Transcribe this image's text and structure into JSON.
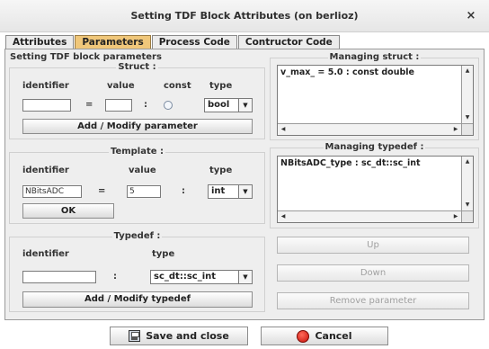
{
  "window": {
    "title": "Setting TDF Block Attributes (on berlioz)",
    "close_glyph": "×"
  },
  "tabs": [
    {
      "label": "Attributes",
      "active": false
    },
    {
      "label": "Parameters",
      "active": true
    },
    {
      "label": "Process Code",
      "active": false
    },
    {
      "label": "Contructor Code",
      "active": false
    }
  ],
  "setting": {
    "title": "Setting TDF block parameters"
  },
  "struct": {
    "title": "Struct :",
    "col_identifier": "identifier",
    "col_value": "value",
    "col_const": "const",
    "col_type": "type",
    "identifier_value": "",
    "equals": "=",
    "value_value": "",
    "colon": ":",
    "type_value": "bool",
    "button_label": "Add / Modify parameter"
  },
  "template": {
    "title": "Template :",
    "col_identifier": "identifier",
    "col_value": "value",
    "col_type": "type",
    "identifier_value": "NBitsADC",
    "equals": "=",
    "value_value": "5",
    "colon": ":",
    "type_value": "int",
    "button_label": "OK"
  },
  "typedef": {
    "title": "Typedef :",
    "col_identifier": "identifier",
    "col_type": "type",
    "identifier_value": "",
    "colon": ":",
    "type_value": "sc_dt::sc_int",
    "button_label": "Add / Modify typedef"
  },
  "managing_struct": {
    "title": "Managing struct :",
    "items": [
      "v_max_ = 5.0 : const double"
    ]
  },
  "managing_typedef": {
    "title": "Managing typedef :",
    "items": [
      "NBitsADC_type : sc_dt::sc_int"
    ]
  },
  "actions": {
    "up_label": "Up",
    "down_label": "Down",
    "remove_label": "Remove parameter"
  },
  "footer": {
    "save_label": "Save and close",
    "cancel_label": "Cancel"
  },
  "scroll_glyphs": {
    "up": "▲",
    "down": "▼",
    "left": "◀",
    "right": "▶"
  },
  "icons": {
    "save": "floppy-disk-icon",
    "cancel": "stop-sign-icon"
  },
  "colors": {
    "active_tab": "#f0c77a",
    "cancel_icon": "#d4140c"
  }
}
